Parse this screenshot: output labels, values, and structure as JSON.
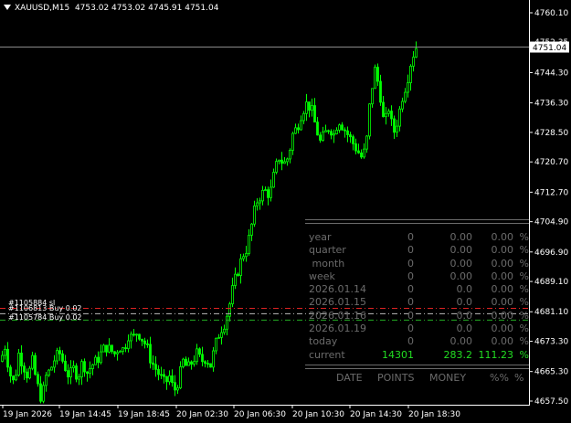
{
  "header": {
    "symbol": "XAUUSD,M15",
    "open": "4753.02",
    "high": "4753.02",
    "low": "4745.91",
    "close": "4751.04"
  },
  "price_axis": {
    "labels": [
      "4760.10",
      "4752.35",
      "4744.30",
      "4736.30",
      "4728.50",
      "4720.70",
      "4712.70",
      "4704.90",
      "4696.90",
      "4689.10",
      "4681.10",
      "4673.30",
      "4665.30",
      "4657.50"
    ],
    "current_price": "4751.04"
  },
  "time_axis": {
    "labels": [
      "19 Jan 2026",
      "19 Jan 14:45",
      "19 Jan 18:45",
      "20 Jan 02:30",
      "20 Jan 06:30",
      "20 Jan 10:30",
      "20 Jan 14:30",
      "20 Jan 18:30"
    ]
  },
  "orders": [
    {
      "text": "#1105884 sl",
      "price": 4682.0,
      "color": "#dd2222"
    },
    {
      "text": "#1106813 Buy 0.02",
      "price": 4680.6,
      "color": "#bbbbbb"
    },
    {
      "text": "#1105784 Buy 0.02",
      "price": 4678.9,
      "color": "#22aa22"
    }
  ],
  "stats": {
    "rows": [
      {
        "label": "year",
        "points": "0",
        "money": "0.00",
        "pct": "0.00",
        "sign": "%"
      },
      {
        "label": "quarter",
        "points": "0",
        "money": "0.00",
        "pct": "0.00",
        "sign": "%"
      },
      {
        "label": " month",
        "points": "0",
        "money": "0.00",
        "pct": "0.00",
        "sign": "%"
      },
      {
        "label": "week",
        "points": "0",
        "money": "0.00",
        "pct": "0.00",
        "sign": "%"
      },
      {
        "label": "2026.01.14",
        "points": "0",
        "money": "0.0",
        "pct": "0.00",
        "sign": "%"
      },
      {
        "label": "2026.01.15",
        "points": "0",
        "money": "0.0",
        "pct": "0.00",
        "sign": "%"
      },
      {
        "label": "2026.01.16",
        "points": "0",
        "money": "0.0",
        "pct": "0.00",
        "sign": "%"
      },
      {
        "label": "2026.01.19",
        "points": "0",
        "money": "0.0",
        "pct": "0.00",
        "sign": "%"
      },
      {
        "label": "today",
        "points": "0",
        "money": "0.00",
        "pct": "0.00",
        "sign": "%"
      }
    ],
    "current": {
      "label": "current",
      "points": "14301",
      "money": "283.2",
      "pct": "111.23",
      "sign": "%"
    },
    "columns": {
      "date": "DATE",
      "points": "POINTS",
      "money": "MONEY",
      "pct": "%%",
      "sign": "%"
    }
  },
  "chart_data": {
    "type": "candlestick",
    "symbol": "XAUUSD",
    "timeframe": "M15",
    "ylim": [
      4655.5,
      4763.0
    ],
    "current_price": 4751.04,
    "bull_color": "#00ff00",
    "bear_color": "#00ff00",
    "grid": false,
    "close_path": [
      [
        0,
        4668
      ],
      [
        5,
        4672
      ],
      [
        10,
        4665
      ],
      [
        15,
        4662
      ],
      [
        20,
        4670
      ],
      [
        25,
        4667
      ],
      [
        30,
        4664
      ],
      [
        35,
        4668
      ],
      [
        40,
        4662
      ],
      [
        45,
        4658
      ],
      [
        50,
        4664
      ],
      [
        55,
        4666
      ],
      [
        60,
        4669
      ],
      [
        65,
        4670
      ],
      [
        70,
        4667
      ],
      [
        75,
        4664
      ],
      [
        80,
        4666
      ],
      [
        85,
        4664
      ],
      [
        90,
        4668
      ],
      [
        95,
        4665
      ],
      [
        100,
        4667
      ],
      [
        105,
        4668
      ],
      [
        110,
        4670
      ],
      [
        115,
        4672
      ],
      [
        120,
        4671
      ],
      [
        125,
        4670
      ],
      [
        130,
        4672
      ],
      [
        135,
        4671
      ],
      [
        140,
        4675
      ],
      [
        145,
        4674
      ],
      [
        150,
        4676
      ],
      [
        155,
        4674
      ],
      [
        160,
        4672
      ],
      [
        165,
        4668
      ],
      [
        170,
        4666
      ],
      [
        175,
        4664
      ],
      [
        180,
        4662
      ],
      [
        185,
        4664
      ],
      [
        190,
        4660
      ],
      [
        195,
        4663
      ],
      [
        200,
        4668
      ],
      [
        205,
        4666
      ],
      [
        210,
        4668
      ],
      [
        215,
        4670
      ],
      [
        220,
        4668
      ],
      [
        225,
        4669
      ],
      [
        230,
        4667
      ],
      [
        235,
        4672
      ],
      [
        240,
        4676
      ],
      [
        245,
        4678
      ],
      [
        250,
        4682
      ],
      [
        255,
        4688
      ],
      [
        260,
        4692
      ],
      [
        265,
        4696
      ],
      [
        270,
        4698
      ],
      [
        275,
        4704
      ],
      [
        280,
        4710
      ],
      [
        285,
        4712
      ],
      [
        290,
        4713
      ],
      [
        295,
        4712
      ],
      [
        300,
        4718
      ],
      [
        305,
        4722
      ],
      [
        310,
        4720
      ],
      [
        315,
        4722
      ],
      [
        320,
        4728
      ],
      [
        325,
        4730
      ],
      [
        330,
        4734
      ],
      [
        335,
        4736
      ],
      [
        340,
        4735
      ],
      [
        345,
        4730
      ],
      [
        350,
        4726
      ],
      [
        355,
        4728
      ],
      [
        360,
        4730
      ],
      [
        365,
        4728
      ],
      [
        370,
        4732
      ],
      [
        375,
        4730
      ],
      [
        380,
        4728
      ],
      [
        385,
        4726
      ],
      [
        390,
        4724
      ],
      [
        395,
        4722
      ],
      [
        400,
        4724
      ],
      [
        405,
        4738
      ],
      [
        410,
        4745
      ],
      [
        415,
        4740
      ],
      [
        420,
        4730
      ],
      [
        425,
        4735
      ],
      [
        430,
        4728
      ],
      [
        435,
        4732
      ],
      [
        440,
        4738
      ],
      [
        445,
        4742
      ],
      [
        450,
        4748
      ],
      [
        455,
        4751
      ]
    ]
  }
}
